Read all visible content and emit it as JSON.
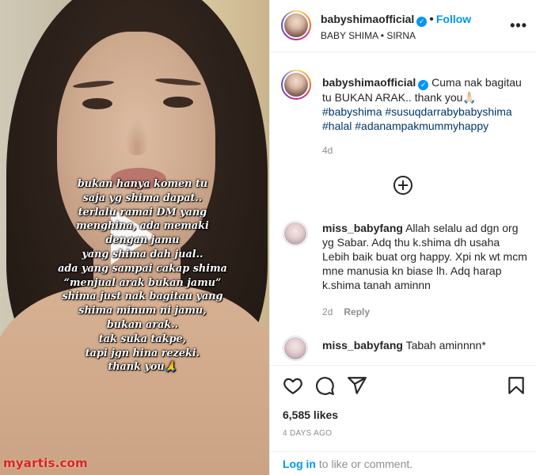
{
  "media": {
    "overlay_lines": [
      "bukan hanya komen tu",
      "saja yg shima dapat..",
      "terlalu ramai DM yang",
      "menghina, ada memaki",
      "dengan jamu",
      "yang shima dah jual..",
      "ada yang sampai cakap shima",
      "“menjual arak bukan jamu”",
      "shima just nak bagitau yang",
      "shima minum ni jamu,",
      "bukan arak..",
      "tak suka takpe,",
      "tapi jgn hina rezeki.",
      "thank you🙏"
    ],
    "watermark": "myartis.com"
  },
  "header": {
    "username": "babyshimaofficial",
    "verified_glyph": "✓",
    "separator": "•",
    "follow_label": "Follow",
    "subtitle": "BABY SHIMA • SIRNA",
    "more_glyph": "•••"
  },
  "caption": {
    "username": "babyshimaofficial",
    "text": "Cuma nak bagitau tu BUKAN ARAK.. thank you🙏🏻",
    "hashtags": "#babyshima #susuqdarrabybabyshima #halal #adanampakmummyhappy",
    "time": "4d"
  },
  "comments": [
    {
      "username": "miss_babyfang",
      "text": "Allah selalu ad dgn org yg Sabar. Adq thu k.shima dh usaha Lebih baik buat org happy. Xpi nk wt mcm mne manusia kn biase lh. Adq harap k.shima tanah aminnn",
      "time": "2d",
      "reply_label": "Reply"
    },
    {
      "username": "miss_babyfang",
      "text": "Tabah aminnnn*"
    }
  ],
  "actions": {
    "likes": "6,585 likes",
    "date": "4 DAYS AGO",
    "icons": [
      "heart-icon",
      "comment-icon",
      "share-icon",
      "bookmark-icon"
    ]
  },
  "login": {
    "link": "Log in",
    "rest": " to like or comment."
  },
  "colors": {
    "accent": "#0095f6",
    "hashtag": "#00376b",
    "muted": "#8e8e8e",
    "watermark": "#e02020"
  }
}
